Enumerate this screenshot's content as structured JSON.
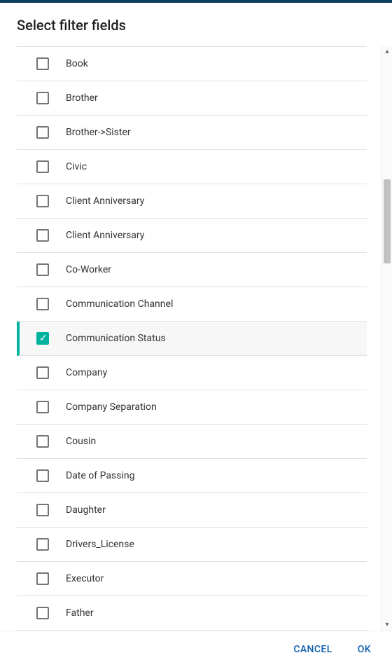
{
  "header": {
    "title": "Select filter fields"
  },
  "items": [
    {
      "label": "Book",
      "selected": false
    },
    {
      "label": "Brother",
      "selected": false
    },
    {
      "label": "Brother->Sister",
      "selected": false
    },
    {
      "label": "Civic",
      "selected": false
    },
    {
      "label": "Client Anniversary",
      "selected": false
    },
    {
      "label": "Client Anniversary",
      "selected": false
    },
    {
      "label": "Co-Worker",
      "selected": false
    },
    {
      "label": "Communication Channel",
      "selected": false
    },
    {
      "label": "Communication Status",
      "selected": true
    },
    {
      "label": "Company",
      "selected": false
    },
    {
      "label": "Company Separation",
      "selected": false
    },
    {
      "label": "Cousin",
      "selected": false
    },
    {
      "label": "Date of Passing",
      "selected": false
    },
    {
      "label": "Daughter",
      "selected": false
    },
    {
      "label": "Drivers_License",
      "selected": false
    },
    {
      "label": "Executor",
      "selected": false
    },
    {
      "label": "Father",
      "selected": false
    }
  ],
  "footer": {
    "cancel": "CANCEL",
    "ok": "OK"
  },
  "colors": {
    "accent": "#00b39e",
    "action": "#0d5fb0",
    "top_bar": "#0d3d5c"
  }
}
